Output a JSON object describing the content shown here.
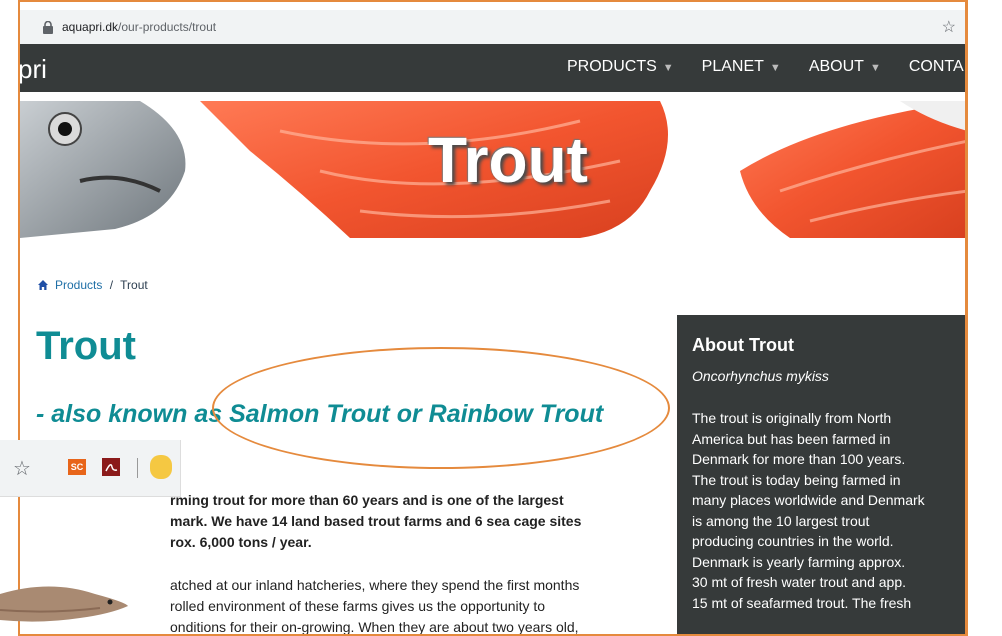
{
  "browser": {
    "url_domain": "aquapri.dk",
    "url_path": "/our-products/trout"
  },
  "nav": {
    "logo_text": "pri",
    "items": [
      {
        "label": "PRODUCTS"
      },
      {
        "label": "PLANET"
      },
      {
        "label": "ABOUT"
      },
      {
        "label": "CONTA"
      }
    ]
  },
  "banner": {
    "title": "Trout"
  },
  "breadcrumb": {
    "products": "Products",
    "separator": "/",
    "current": "Trout"
  },
  "main": {
    "heading": "Trout",
    "subheading": "- also known as Salmon Trout or Rainbow Trout",
    "para1_lines": [
      "rming trout for more than 60 years and is one of the largest",
      "mark. We have 14 land based trout farms and 6 sea cage sites",
      "rox. 6,000 tons / year."
    ],
    "para2_lines": [
      "atched at our inland hatcheries, where they spend the first months",
      "rolled environment of these farms gives us the opportunity to",
      "onditions for their on-growing. When they are about two years old,"
    ]
  },
  "aside": {
    "title": "About Trout",
    "latin_name": "Oncorhynchus mykiss",
    "text": "The trout is originally from North\nAmerica but has been farmed in\nDenmark for more than 100 years.\nThe trout is today being farmed in\nmany places worldwide and Denmark\nis among the 10 largest trout\nproducing countries in the world.\nDenmark is yearly farming approx.\n30 mt of fresh water trout and app.\n15 mt of seafarmed trout. The fresh"
  },
  "overlay_toolbar": {
    "sc_label": "SC"
  },
  "colors": {
    "accent_teal": "#0f8c94",
    "nav_dark": "#363a3a",
    "highlight_orange": "#e58a3d"
  }
}
